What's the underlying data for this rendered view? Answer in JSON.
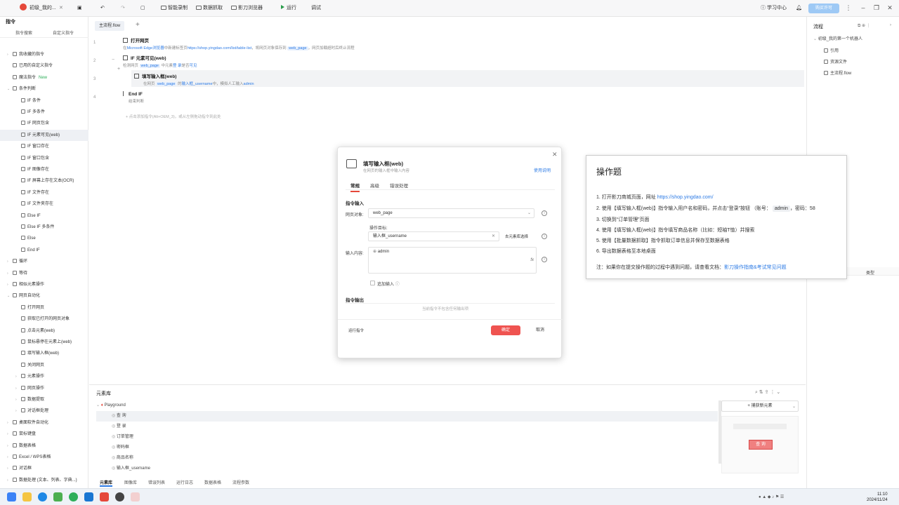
{
  "titlebar": {
    "title": "初级_我的...",
    "smart_record": "智能录制",
    "data_grab": "数据抓取",
    "browser": "影刀浏览器",
    "run": "运行",
    "debug": "调试",
    "learn": "学习中心",
    "upgrade": "购买许可"
  },
  "left": {
    "header": "指令",
    "tabs": [
      "指令搜索",
      "自定义指令"
    ],
    "items": [
      {
        "label": "我收藏的指令",
        "arrow": "›",
        "indent": 0
      },
      {
        "label": "已用的自定义指令",
        "arrow": "",
        "indent": 0
      },
      {
        "label": "魔法指令",
        "arrow": "",
        "indent": 0,
        "badge": "New"
      },
      {
        "label": "条件判断",
        "arrow": "⌄",
        "indent": 0
      },
      {
        "label": "IF 条件",
        "arrow": "",
        "indent": 1
      },
      {
        "label": "IF 多条件",
        "arrow": "",
        "indent": 1
      },
      {
        "label": "IF 网页包含",
        "arrow": "",
        "indent": 1
      },
      {
        "label": "IF 元素可见(web)",
        "arrow": "",
        "indent": 1,
        "sel": true
      },
      {
        "label": "IF 窗口存在",
        "arrow": "",
        "indent": 1
      },
      {
        "label": "IF 窗口包含",
        "arrow": "",
        "indent": 1
      },
      {
        "label": "IF 图像存在",
        "arrow": "",
        "indent": 1
      },
      {
        "label": "IF 屏幕上存在文本(OCR)",
        "arrow": "",
        "indent": 1
      },
      {
        "label": "IF 文件存在",
        "arrow": "",
        "indent": 1
      },
      {
        "label": "IF 文件夹存在",
        "arrow": "",
        "indent": 1
      },
      {
        "label": "Else IF",
        "arrow": "",
        "indent": 1
      },
      {
        "label": "Else IF 多条件",
        "arrow": "",
        "indent": 1
      },
      {
        "label": "Else",
        "arrow": "",
        "indent": 1
      },
      {
        "label": "End IF",
        "arrow": "",
        "indent": 1
      },
      {
        "label": "循环",
        "arrow": "›",
        "indent": 0
      },
      {
        "label": "等待",
        "arrow": "›",
        "indent": 0
      },
      {
        "label": "相似元素操作",
        "arrow": "›",
        "indent": 0
      },
      {
        "label": "网页自动化",
        "arrow": "⌄",
        "indent": 0
      },
      {
        "label": "打开网页",
        "arrow": "",
        "indent": 1
      },
      {
        "label": "获取已打开的网页对象",
        "arrow": "",
        "indent": 1
      },
      {
        "label": "点击元素(web)",
        "arrow": "",
        "indent": 1
      },
      {
        "label": "鼠标悬停在元素上(web)",
        "arrow": "",
        "indent": 1
      },
      {
        "label": "填写输入框(web)",
        "arrow": "",
        "indent": 1
      },
      {
        "label": "关闭网页",
        "arrow": "",
        "indent": 1
      },
      {
        "label": "元素操作",
        "arrow": "›",
        "indent": 1
      },
      {
        "label": "网页操作",
        "arrow": "›",
        "indent": 1
      },
      {
        "label": "数据提取",
        "arrow": "›",
        "indent": 1
      },
      {
        "label": "对话框处理",
        "arrow": "›",
        "indent": 1
      },
      {
        "label": "桌面软件自动化",
        "arrow": "›",
        "indent": 0
      },
      {
        "label": "鼠标键盘",
        "arrow": "›",
        "indent": 0
      },
      {
        "label": "数据表格",
        "arrow": "›",
        "indent": 0
      },
      {
        "label": "Excel / WPS表格",
        "arrow": "›",
        "indent": 0
      },
      {
        "label": "对话框",
        "arrow": "›",
        "indent": 0
      },
      {
        "label": "数据处理 (文本、列表、字典...)",
        "arrow": "›",
        "indent": 0
      }
    ]
  },
  "flow": {
    "tab": "主流程.flow",
    "add": "+",
    "steps": [
      {
        "no": "1",
        "title": "打开网页",
        "desc_pre": "在",
        "desc_l1": "Microsoft Edge浏览器",
        "desc_m": "中新建标签页",
        "desc_l2": "https://shop.yingdao.com/list/table-list",
        "desc_m2": "，将网页对象保存到",
        "chip": "web_page",
        "desc_post": "，网页加载超时后终止流程"
      },
      {
        "no": "2",
        "title": "IF 元素可见(web)",
        "desc_pre": "检测网页",
        "chip": "web_page",
        "desc_m": "中元素",
        "desc_l1": "登 录",
        "desc_post": "是否",
        "desc_l2": "可见"
      },
      {
        "no": "3",
        "title": "填写输入框(web)",
        "desc_pre": "在网页",
        "chip": "web_page",
        "desc_m": "的",
        "desc_l1": "输入框_username",
        "desc_post": "中，模拟人工输入",
        "desc_l2": "admin"
      },
      {
        "no": "4",
        "title": "End IF",
        "desc_pre": "结束判断"
      }
    ],
    "hint": "+ 点击添加指令(Alt+OEM_3)，或从左侧拖动指令到此处"
  },
  "right": {
    "title": "流程",
    "project": "初级_我的第一个机器人",
    "items": [
      "引用",
      "资源文件",
      "主流程.flow"
    ],
    "col": "类型"
  },
  "bottom": {
    "title": "元素库",
    "root": "Playground",
    "items": [
      "查 询",
      "登 录",
      "订单管理",
      "密码框",
      "商品名称",
      "输入框_username"
    ],
    "capture": "+ 捕获新元素",
    "tabs": [
      "元素库",
      "图像库",
      "错误列表",
      "运行日志",
      "数据表格",
      "流程参数"
    ],
    "preview_btn": "查 询"
  },
  "modal": {
    "title": "填写输入框(web)",
    "subtitle": "在网页的输入框中输入内容",
    "help": "使用说明",
    "tabs": [
      "常规",
      "高级",
      "错误处理"
    ],
    "sec_input": "指令输入",
    "page_label": "网页对象:",
    "page_value": "web_page",
    "target_label": "操作目标:",
    "target_value": "输入框_username",
    "target_btn": "去元素库选择",
    "content_label": "输入内容:",
    "content_value": "admin",
    "append": "追加输入",
    "sec_output": "指令输出",
    "no_output": "当前指令不包含任何输出项",
    "run_btn": "运行指令",
    "ok": "确定",
    "cancel": "取消"
  },
  "task": {
    "title": "操作题",
    "l1_pre": "1. 打开影刀商城页面，网址",
    "l1_link": "https://shop.yingdao.com/",
    "l2_pre": "2. 使用【填写输入框(web)】指令输入用户名和密码，并点击“登录”按钮 （账号：",
    "l2_code": "admin",
    "l2_post": "，密码：58",
    "l3": "3. 切换到“订单管理”页面",
    "l4": "4. 使用【填写输入框(web)】指令填写商品名称（比如：短袖T恤）并搜索",
    "l5": "5. 使用【批量数据抓取】指令抓取订单信息并保存至数据表格",
    "l6": "6. 导出数据表格至本地桌面",
    "note_pre": "注：如果你在提交操作题的过程中遇到问题，请查看文档：",
    "note_link": "影刀操作指南&考试常见问题"
  },
  "taskbar": {
    "time": "11:10",
    "date": "2024/11/24"
  }
}
